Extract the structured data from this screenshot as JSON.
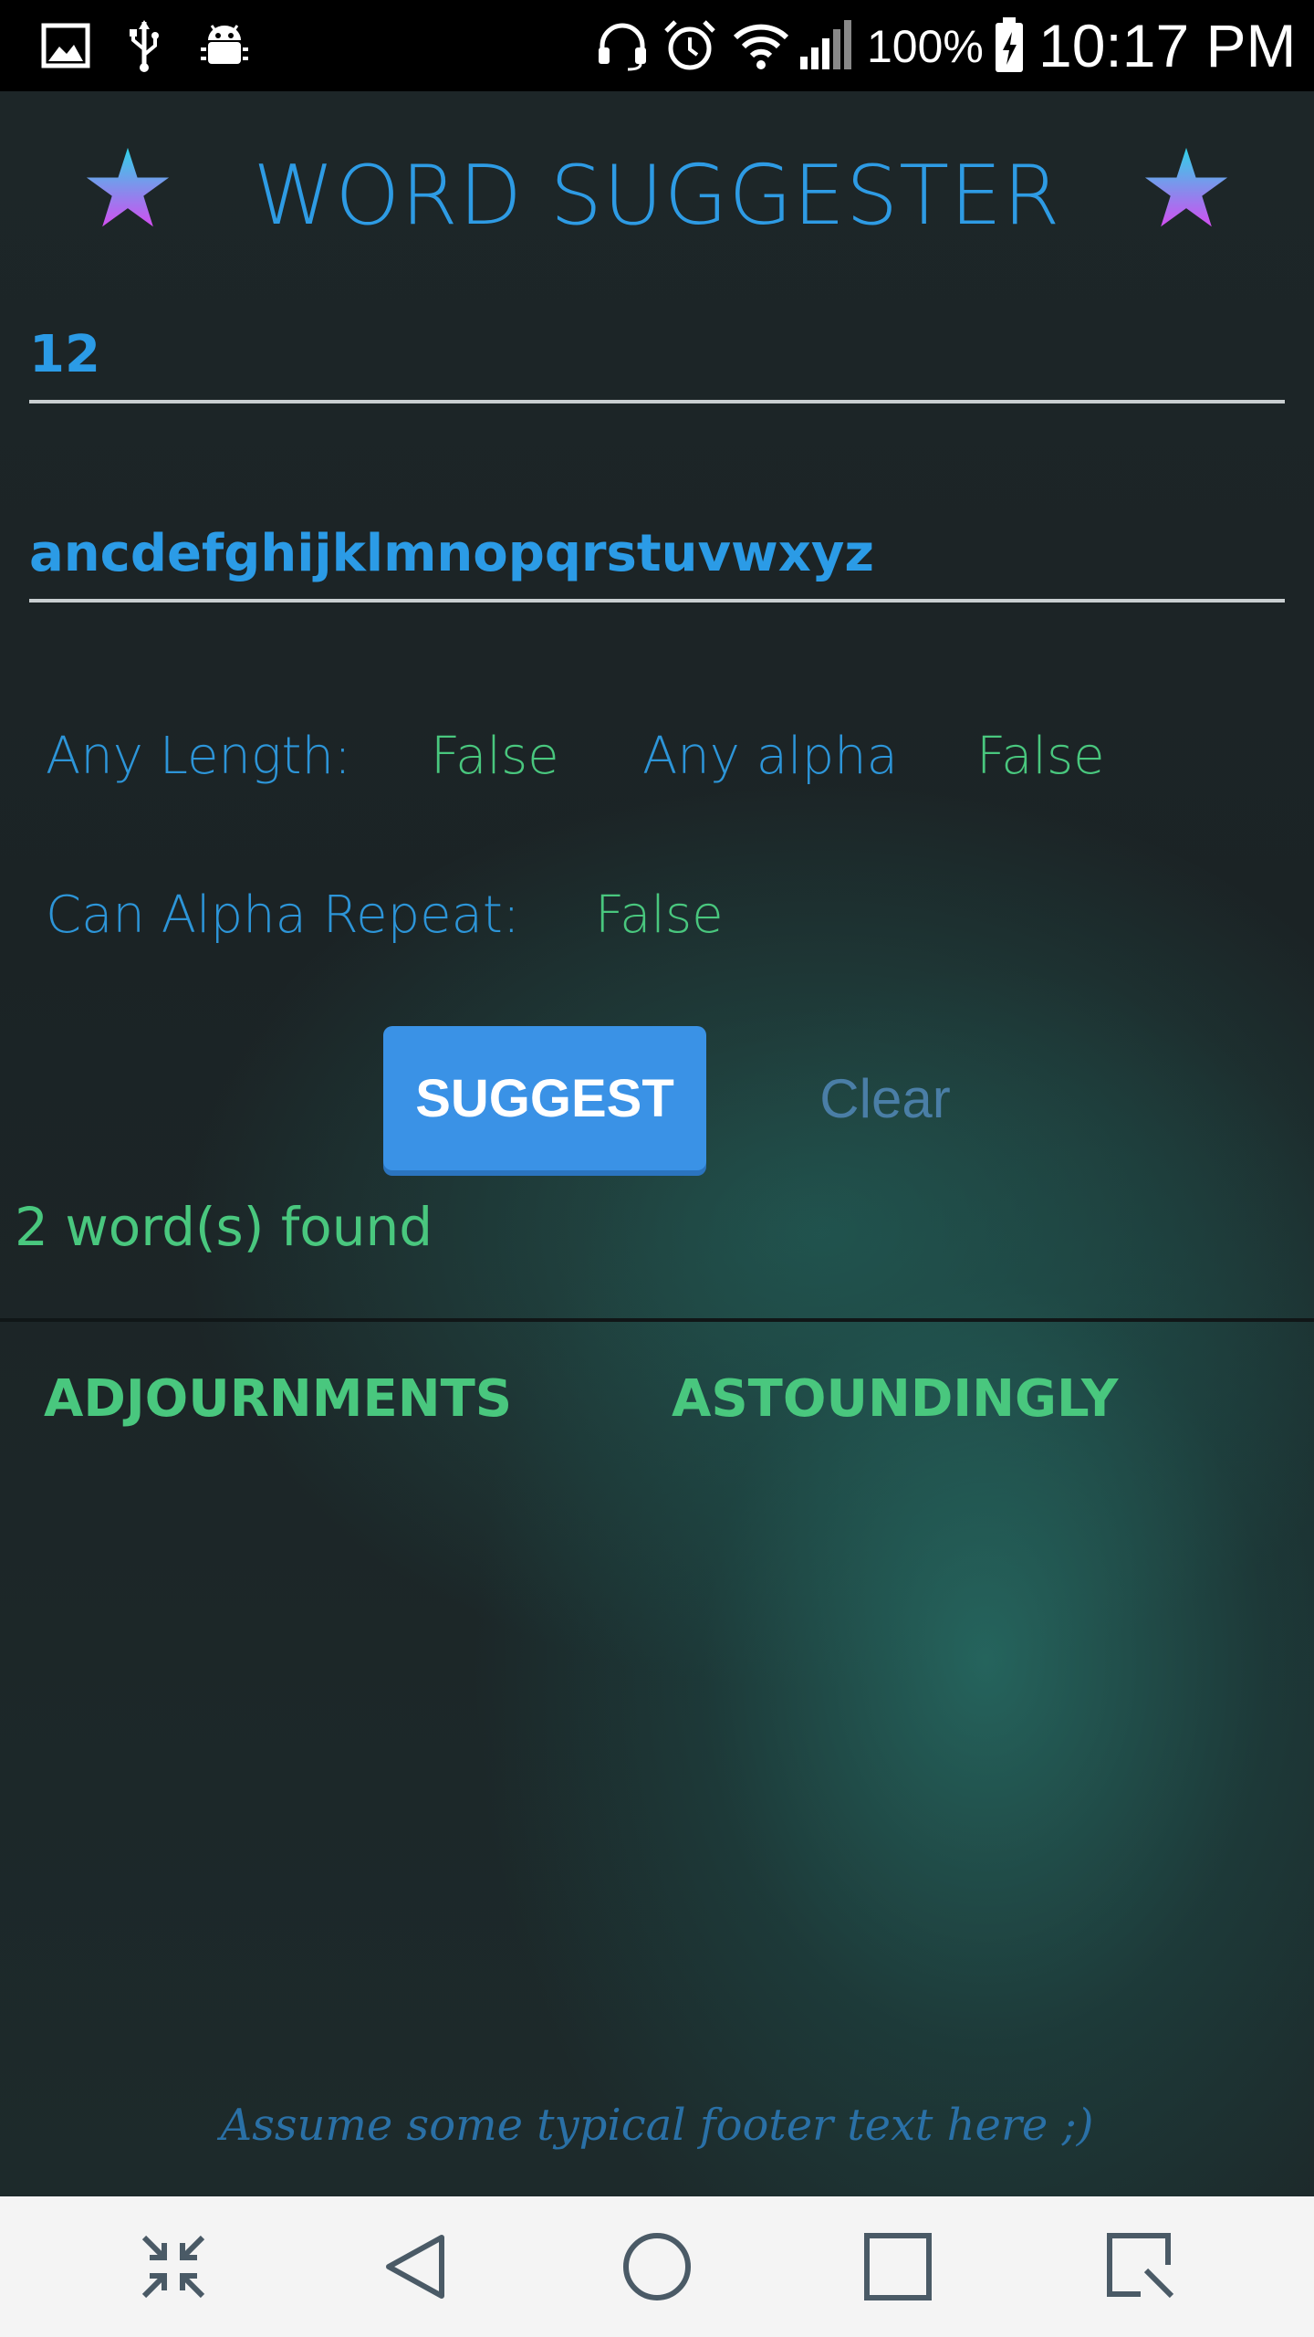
{
  "status_bar": {
    "battery": "100%",
    "time": "10:17 PM",
    "icons": [
      "image-icon",
      "usb-icon",
      "android-debug-icon",
      "headset-icon",
      "alarm-icon",
      "wifi-icon",
      "signal-icon",
      "battery-charging-icon"
    ]
  },
  "header": {
    "title": "WORD SUGGESTER",
    "left_icon": "star-icon",
    "right_icon": "star-icon"
  },
  "inputs": {
    "length_value": "12",
    "alphabet_value": "ancdefghijklmnopqrstuvwxyz"
  },
  "options": {
    "any_length_label": "Any Length:",
    "any_length_value": "False",
    "any_alpha_label": "Any alpha",
    "any_alpha_value": "False",
    "can_repeat_label": "Can Alpha Repeat:",
    "can_repeat_value": "False"
  },
  "actions": {
    "suggest_label": "SUGGEST",
    "clear_label": "Clear"
  },
  "results": {
    "count_text": "2 word(s) found",
    "words": [
      "ADJOURNMENTS",
      "ASTOUNDINGLY"
    ]
  },
  "footer": {
    "text": "Assume some typical footer text here ;)"
  },
  "nav_bar": {
    "icons": [
      "collapse-icon",
      "back-icon",
      "home-icon",
      "recents-icon",
      "screenshot-icon"
    ]
  },
  "colors": {
    "accent_blue": "#2e9be4",
    "accent_green": "#49c77e",
    "button_blue": "#3a92e6",
    "background": "#1d2628"
  }
}
